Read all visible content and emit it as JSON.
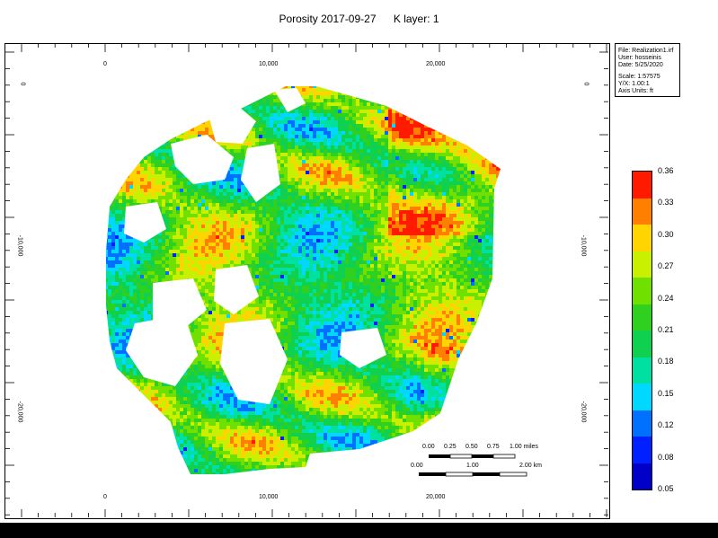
{
  "title": {
    "property": "Porosity 2017-09-27",
    "layer": "K layer: 1"
  },
  "info": {
    "file": "File: Realization1.irf",
    "user": "User: hosseinis",
    "date": "Date: 5/25/2020",
    "scale": "Scale: 1:57575",
    "yx": "Y/X: 1.00:1",
    "units": "Axis Units: ft"
  },
  "axes": {
    "x_top": [
      "0",
      "10,000",
      "20,000"
    ],
    "x_bottom": [
      "0",
      "10,000",
      "20,000"
    ],
    "y_left": [
      "0",
      "-10,000",
      "-20,000"
    ],
    "y_right": [
      "0",
      "-10,000",
      "-20,000"
    ]
  },
  "legend": {
    "labels": [
      "0.36",
      "0.33",
      "0.30",
      "0.27",
      "0.24",
      "0.21",
      "0.18",
      "0.15",
      "0.12",
      "0.08",
      "0.05"
    ],
    "colors": [
      "#ff1a00",
      "#ff7f00",
      "#ffd400",
      "#c8f000",
      "#60e000",
      "#20d040",
      "#00e070",
      "#00e0b0",
      "#00c8ff",
      "#0070ff",
      "#0010d0"
    ]
  },
  "scalebar": {
    "miles_labels": [
      "0.00",
      "0.25",
      "0.50",
      "0.75",
      "1.00 miles"
    ],
    "km_labels": [
      "0.00",
      "1.00",
      "2.00 km"
    ]
  }
}
